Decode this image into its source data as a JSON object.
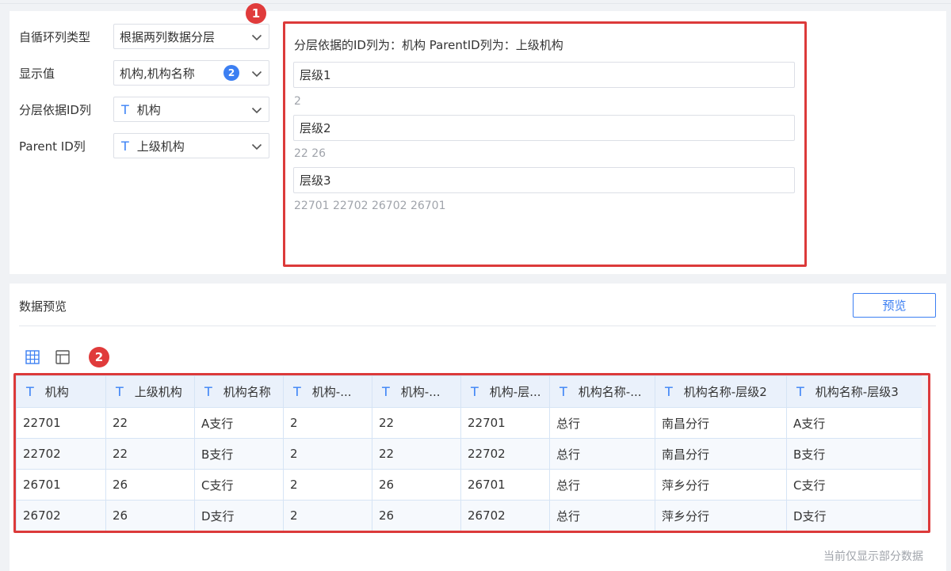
{
  "config": {
    "fields": [
      {
        "label": "自循环列类型",
        "value": "根据两列数据分层",
        "typed": false
      },
      {
        "label": "显示值",
        "value": "机构,机构名称",
        "badge": "2",
        "typed": false
      },
      {
        "label": "分层依据ID列",
        "value": "机构",
        "typed": true,
        "type_icon": "T"
      },
      {
        "label": "Parent ID列",
        "value": "上级机构",
        "typed": true,
        "type_icon": "T"
      }
    ],
    "hierarchy": {
      "title": "分层依据的ID列为：机构  ParentID列为：上级机构",
      "levels": [
        {
          "name": "层级1",
          "values": "2"
        },
        {
          "name": "层级2",
          "values": "22  26"
        },
        {
          "name": "层级3",
          "values": "22701  22702  26702  26701"
        }
      ]
    }
  },
  "preview": {
    "title": "数据预览",
    "button_label": "预览",
    "footnote": "当前仅显示部分数据",
    "type_icon": "T",
    "columns": [
      "机构",
      "上级机构",
      "机构名称",
      "机构-...",
      "机构-...",
      "机构-层...",
      "机构名称-...",
      "机构名称-层级2",
      "机构名称-层级3"
    ],
    "rows": [
      [
        "22701",
        "22",
        "A支行",
        "2",
        "22",
        "22701",
        "总行",
        "南昌分行",
        "A支行"
      ],
      [
        "22702",
        "22",
        "B支行",
        "2",
        "22",
        "22702",
        "总行",
        "南昌分行",
        "B支行"
      ],
      [
        "26701",
        "26",
        "C支行",
        "2",
        "26",
        "26701",
        "总行",
        "萍乡分行",
        "C支行"
      ],
      [
        "26702",
        "26",
        "D支行",
        "2",
        "26",
        "26702",
        "总行",
        "萍乡分行",
        "D支行"
      ]
    ]
  },
  "markers": [
    "1",
    "2"
  ],
  "colors": {
    "accent": "#3c7ff2",
    "highlight_border": "#dc3a3a",
    "type_icon": "#3b82f6",
    "marker": "#e03b3b"
  }
}
